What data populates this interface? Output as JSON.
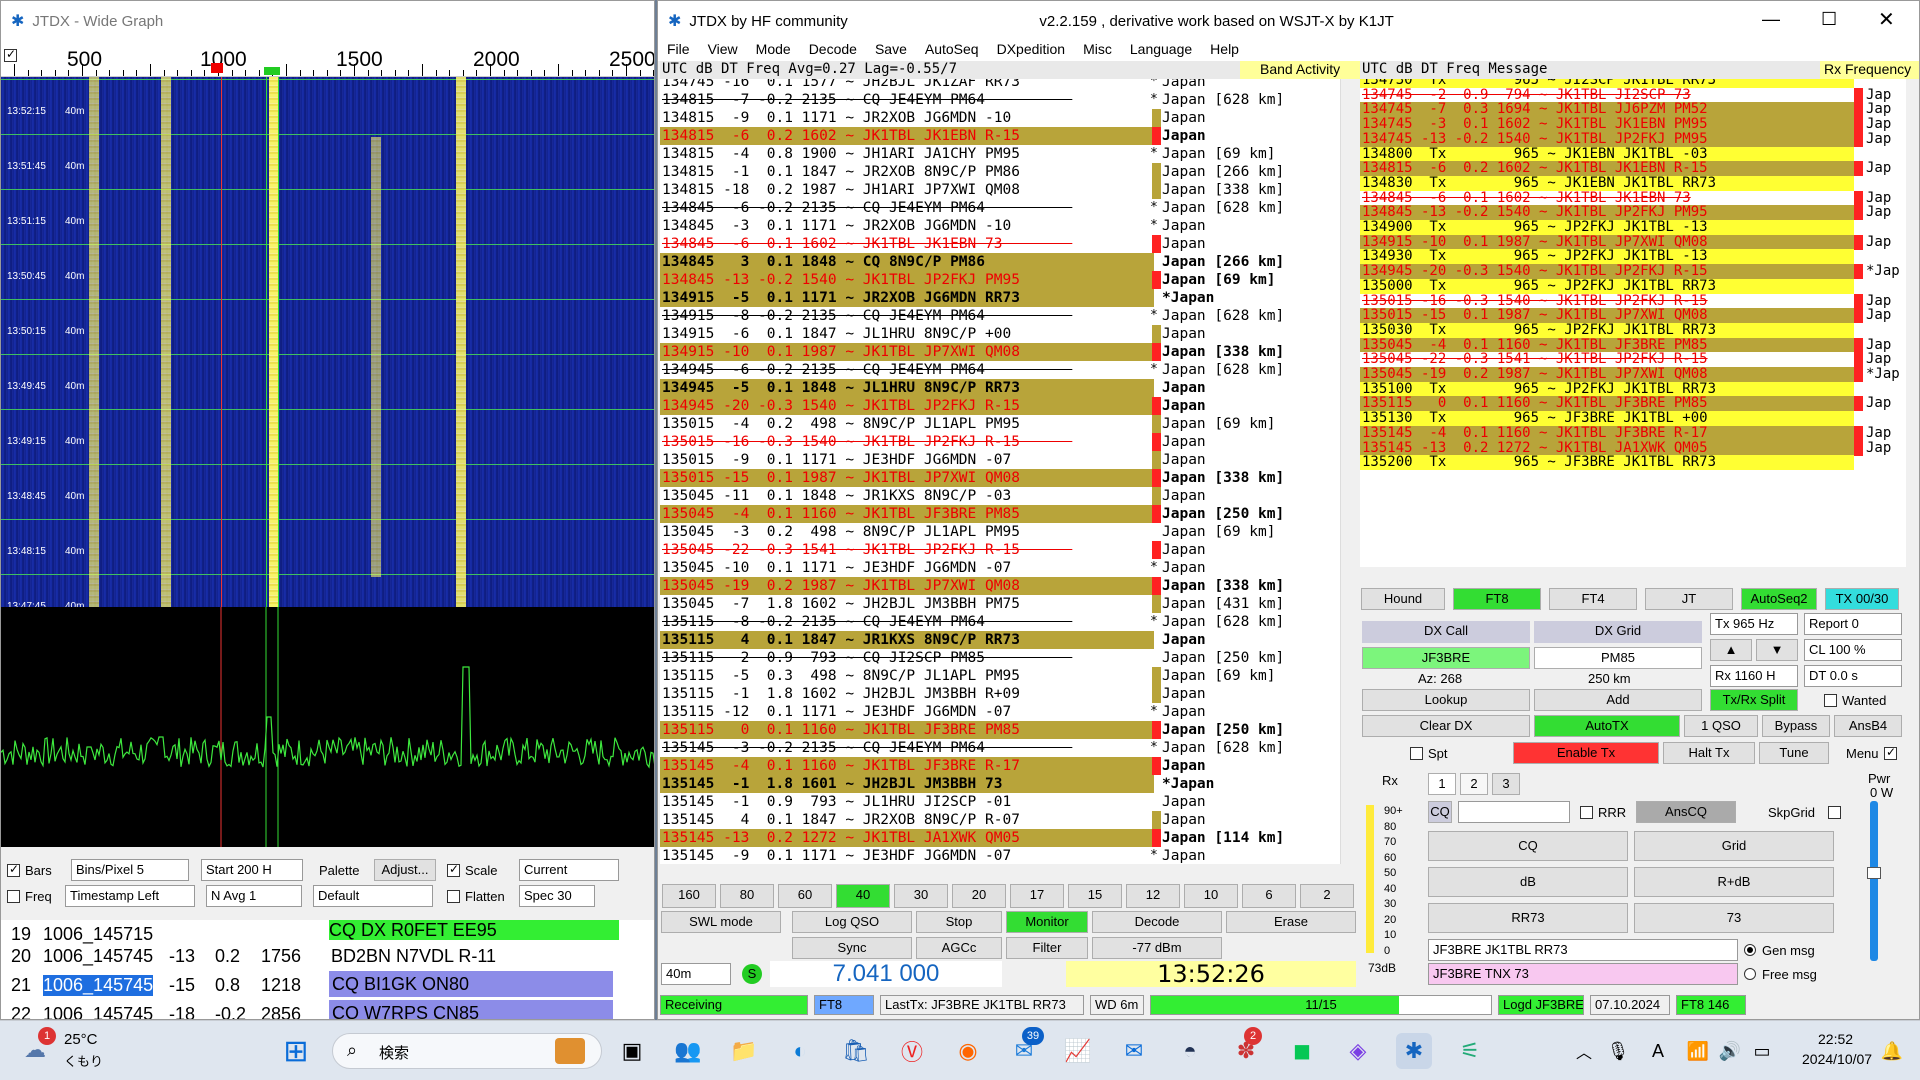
{
  "wide_graph": {
    "title": "JTDX - Wide Graph",
    "scale": [
      "500",
      "1000",
      "1500",
      "2000",
      "2500"
    ],
    "rows": [
      {
        "ts": "13:52:15",
        "band": "40m"
      },
      {
        "ts": "13:51:45",
        "band": "40m"
      },
      {
        "ts": "13:51:15",
        "band": "40m"
      },
      {
        "ts": "13:50:45",
        "band": "40m"
      },
      {
        "ts": "13:50:15",
        "band": "40m"
      },
      {
        "ts": "13:49:45",
        "band": "40m"
      },
      {
        "ts": "13:49:15",
        "band": "40m"
      },
      {
        "ts": "13:48:45",
        "band": "40m"
      },
      {
        "ts": "13:48:15",
        "band": "40m"
      },
      {
        "ts": "13:47:45",
        "band": "40m"
      }
    ],
    "ctrl": {
      "bars": "Bars",
      "bins": "Bins/Pixel  5",
      "start": "Start 200 H",
      "palette": "Palette",
      "adjust": "Adjust...",
      "scale": "Scale",
      "current": "Current",
      "freq": "Freq",
      "timestamp": "Timestamp Left",
      "navg": "N Avg 1",
      "default": "Default",
      "flatten": "Flatten",
      "spec": "Spec 30"
    }
  },
  "log_table": [
    {
      "n": "19",
      "d": "1006_145715",
      "c": "CQ DX R0FET EE95"
    },
    {
      "n": "20",
      "d": "1006_145745",
      "db": "-13",
      "dt": "0.2",
      "f": "1756",
      "m": "BD2BN N7VDL R-11"
    },
    {
      "n": "21",
      "d": "1006_145745",
      "db": "-15",
      "dt": "0.8",
      "f": "1218",
      "m": "CQ BI1GK ON80"
    },
    {
      "n": "22",
      "d": "1006_145745",
      "db": "-18",
      "dt": "-0.2",
      "f": "2856",
      "m": "CQ W7RPS CN85"
    }
  ],
  "main": {
    "title": "JTDX  by HF community",
    "subtitle": "v2.2.159 , derivative work based on WSJT-X by K1JT",
    "menu": [
      "File",
      "View",
      "Mode",
      "Decode",
      "Save",
      "AutoSeq",
      "DXpedition",
      "Misc",
      "Language",
      "Help"
    ],
    "band_header": "UTC    dB  DT Freq    Avg=0.27 Lag=-0.55/7",
    "band_activity": "Band Activity",
    "rx_header": "UTC    dB  DT Freq    Message",
    "rx_frequency": "Rx Frequency"
  },
  "band_rows": [
    {
      "t": "134745 -16  0.1 1577 ~ JH2BJL JK1ZAF RR73      ",
      "c": "Japan",
      "k": "",
      "s": "x",
      "m": "*"
    },
    {
      "t": "134815  -7 -0.2 2135 ~ CQ JE4EYM PM64          ",
      "c": "Japan [628 km]",
      "k": "",
      "s": "cq",
      "m": "*"
    },
    {
      "t": "134815  -9  0.1 1171 ~ JR2XOB JG6MDN -10       ",
      "c": "Japan",
      "k": "",
      "s": "",
      "m": "o"
    },
    {
      "t": "134815  -6  0.2 1602 ~ JK1TBL JK1EBN R-15      ",
      "c": "Japan",
      "k": "ol",
      "s": "red",
      "m": "r"
    },
    {
      "t": "134815  -4  0.8 1900 ~ JH1ARI JA1CHY PM95      ",
      "c": "Japan [69 km]",
      "k": "",
      "s": "",
      "m": "*"
    },
    {
      "t": "134815  -1  0.1 1847 ~ JR2XOB 8N9C/P PM86      ",
      "c": "Japan [266 km]",
      "k": "",
      "s": "",
      "m": "o"
    },
    {
      "t": "134815 -18  0.2 1987 ~ JH1ARI JP7XWI QM08      ",
      "c": "Japan [338 km]",
      "k": "",
      "s": "",
      "m": "o"
    },
    {
      "t": "134845  -6 -0.2 2135 ~ CQ JE4EYM PM64          ",
      "c": "Japan [628 km]",
      "k": "",
      "s": "cq",
      "m": "*"
    },
    {
      "t": "134845  -3  0.1 1171 ~ JR2XOB JG6MDN -10       ",
      "c": "Japan",
      "k": "",
      "s": "",
      "m": "*"
    },
    {
      "t": "134845  -6  0.1 1602 ~ JK1TBL JK1EBN 73        ",
      "c": "Japan",
      "k": "",
      "s": "strike",
      "m": "r"
    },
    {
      "t": "134845   3  0.1 1848 ~ CQ 8N9C/P PM86          ",
      "c": "Japan [266 km]",
      "k": "ol",
      "s": "bold",
      "m": ""
    },
    {
      "t": "134845 -13 -0.2 1540 ~ JK1TBL JP2FKJ PM95      ",
      "c": "Japan [69 km]",
      "k": "ol",
      "s": "red",
      "m": "r"
    },
    {
      "t": "134915  -5  0.1 1171 ~ JR2XOB JG6MDN RR73      ",
      "c": "*Japan",
      "k": "ol",
      "s": "bold",
      "m": ""
    },
    {
      "t": "134915  -8 -0.2 2135 ~ CQ JE4EYM PM64          ",
      "c": "Japan [628 km]",
      "k": "",
      "s": "cq",
      "m": "*"
    },
    {
      "t": "134915  -6  0.1 1847 ~ JL1HRU 8N9C/P +00       ",
      "c": "Japan",
      "k": "",
      "s": "",
      "m": "o"
    },
    {
      "t": "134915 -10  0.1 1987 ~ JK1TBL JP7XWI QM08      ",
      "c": "Japan [338 km]",
      "k": "ol",
      "s": "red",
      "m": "r"
    },
    {
      "t": "134945  -6 -0.2 2135 ~ CQ JE4EYM PM64          ",
      "c": "Japan [628 km]",
      "k": "",
      "s": "cq",
      "m": "*"
    },
    {
      "t": "134945  -5  0.1 1848 ~ JL1HRU 8N9C/P RR73      ",
      "c": "Japan",
      "k": "ol",
      "s": "bold",
      "m": ""
    },
    {
      "t": "134945 -20 -0.3 1540 ~ JK1TBL JP2FKJ R-15      ",
      "c": "Japan",
      "k": "ol",
      "s": "red",
      "m": "r"
    },
    {
      "t": "135015  -4  0.2  498 ~ 8N9C/P JL1APL PM95      ",
      "c": "Japan [69 km]",
      "k": "",
      "s": "",
      "m": "o"
    },
    {
      "t": "135015 -16 -0.3 1540 ~ JK1TBL JP2FKJ R-15      ",
      "c": "Japan",
      "k": "",
      "s": "strike",
      "m": "r"
    },
    {
      "t": "135015  -9  0.1 1171 ~ JE3HDF JG6MDN -07       ",
      "c": "Japan",
      "k": "",
      "s": "",
      "m": "o"
    },
    {
      "t": "135015 -15  0.1 1987 ~ JK1TBL JP7XWI QM08      ",
      "c": "Japan [338 km]",
      "k": "ol",
      "s": "red",
      "m": "r"
    },
    {
      "t": "135045 -11  0.1 1848 ~ JR1KXS 8N9C/P -03       ",
      "c": "Japan",
      "k": "",
      "s": "",
      "m": "o"
    },
    {
      "t": "135045  -4  0.1 1160 ~ JK1TBL JF3BRE PM85      ",
      "c": "Japan [250 km]",
      "k": "ol",
      "s": "red",
      "m": "r"
    },
    {
      "t": "135045  -3  0.2  498 ~ 8N9C/P JL1APL PM95      ",
      "c": "Japan [69 km]",
      "k": "",
      "s": "",
      "m": ""
    },
    {
      "t": "135045 -22 -0.3 1541 ~ JK1TBL JP2FKJ R-15      ",
      "c": "Japan",
      "k": "",
      "s": "strike",
      "m": "r"
    },
    {
      "t": "135045 -10  0.1 1171 ~ JE3HDF JG6MDN -07       ",
      "c": "Japan",
      "k": "",
      "s": "",
      "m": "*"
    },
    {
      "t": "135045 -19  0.2 1987 ~ JK1TBL JP7XWI QM08      ",
      "c": "Japan [338 km]",
      "k": "ol",
      "s": "red",
      "m": "r"
    },
    {
      "t": "135045  -7  1.8 1602 ~ JH2BJL JM3BBH PM75      ",
      "c": "Japan [431 km]",
      "k": "",
      "s": "",
      "m": "o"
    },
    {
      "t": "135115  -8 -0.2 2135 ~ CQ JE4EYM PM64          ",
      "c": "Japan [628 km]",
      "k": "",
      "s": "cq",
      "m": "*"
    },
    {
      "t": "135115   4  0.1 1847 ~ JR1KXS 8N9C/P RR73      ",
      "c": "Japan",
      "k": "ol",
      "s": "bold",
      "m": ""
    },
    {
      "t": "135115   2  0.9  793 ~ CQ JI2SCP PM85          ",
      "c": "Japan [250 km]",
      "k": "",
      "s": "cq",
      "m": ""
    },
    {
      "t": "135115  -5  0.3  498 ~ 8N9C/P JL1APL PM95      ",
      "c": "Japan [69 km]",
      "k": "",
      "s": "",
      "m": "o"
    },
    {
      "t": "135115  -1  1.8 1602 ~ JH2BJL JM3BBH R+09      ",
      "c": "Japan",
      "k": "",
      "s": "",
      "m": "o"
    },
    {
      "t": "135115 -12  0.1 1171 ~ JE3HDF JG6MDN -07       ",
      "c": "Japan",
      "k": "",
      "s": "",
      "m": "*"
    },
    {
      "t": "135115   0  0.1 1160 ~ JK1TBL JF3BRE PM85      ",
      "c": "Japan [250 km]",
      "k": "ol",
      "s": "red",
      "m": "r"
    },
    {
      "t": "135145  -3 -0.2 2135 ~ CQ JE4EYM PM64          ",
      "c": "Japan [628 km]",
      "k": "",
      "s": "cq",
      "m": "*"
    },
    {
      "t": "135145  -4  0.1 1160 ~ JK1TBL JF3BRE R-17      ",
      "c": "Japan",
      "k": "ol",
      "s": "red",
      "m": "r"
    },
    {
      "t": "135145  -1  1.8 1601 ~ JH2BJL JM3BBH 73        ",
      "c": "*Japan",
      "k": "ol",
      "s": "bold",
      "m": ""
    },
    {
      "t": "135145  -1  0.9  793 ~ JL1HRU JI2SCP -01       ",
      "c": "Japan",
      "k": "",
      "s": "",
      "m": ""
    },
    {
      "t": "135145   4  0.1 1847 ~ JR2XOB 8N9C/P R-07      ",
      "c": "Japan",
      "k": "",
      "s": "",
      "m": "o"
    },
    {
      "t": "135145 -13  0.2 1272 ~ JK1TBL JA1XWK QM05      ",
      "c": "Japan [114 km]",
      "k": "ol",
      "s": "red",
      "m": "r"
    },
    {
      "t": "135145  -9  0.1 1171 ~ JE3HDF JG6MDN -07       ",
      "c": "Japan",
      "k": "",
      "s": "",
      "m": "*"
    }
  ],
  "rx_rows": [
    {
      "t": "134730  Tx        965 ~ JI2SCP JK1TBL RR73",
      "c": "",
      "k": "yel",
      "s": ""
    },
    {
      "t": "134745  -2  0.9  794 ~ JK1TBL JI2SCP 73",
      "c": "Jap",
      "k": "",
      "s": "strike"
    },
    {
      "t": "134745  -7  0.3 1694 ~ JK1TBL JJ6PZM PM52",
      "c": "Jap",
      "k": "ol",
      "s": "red"
    },
    {
      "t": "134745  -3  0.1 1602 ~ JK1TBL JK1EBN PM95",
      "c": "Jap",
      "k": "ol",
      "s": "red"
    },
    {
      "t": "134745 -13 -0.2 1540 ~ JK1TBL JP2FKJ PM95",
      "c": "Jap",
      "k": "ol",
      "s": "red"
    },
    {
      "t": "134800  Tx        965 ~ JK1EBN JK1TBL -03",
      "c": "",
      "k": "yel",
      "s": ""
    },
    {
      "t": "134815  -6  0.2 1602 ~ JK1TBL JK1EBN R-15",
      "c": "Jap",
      "k": "ol",
      "s": "red"
    },
    {
      "t": "134830  Tx        965 ~ JK1EBN JK1TBL RR73",
      "c": "",
      "k": "yel",
      "s": ""
    },
    {
      "t": "134845  -6  0.1 1602 ~ JK1TBL JK1EBN 73",
      "c": "Jap",
      "k": "",
      "s": "strike"
    },
    {
      "t": "134845 -13 -0.2 1540 ~ JK1TBL JP2FKJ PM95",
      "c": "Jap",
      "k": "ol",
      "s": "red"
    },
    {
      "t": "134900  Tx        965 ~ JP2FKJ JK1TBL -13",
      "c": "",
      "k": "yel",
      "s": ""
    },
    {
      "t": "134915 -10  0.1 1987 ~ JK1TBL JP7XWI QM08",
      "c": "Jap",
      "k": "ol",
      "s": "red"
    },
    {
      "t": "134930  Tx        965 ~ JP2FKJ JK1TBL -13",
      "c": "",
      "k": "yel",
      "s": ""
    },
    {
      "t": "134945 -20 -0.3 1540 ~ JK1TBL JP2FKJ R-15",
      "c": "*Jap",
      "k": "ol",
      "s": "red"
    },
    {
      "t": "135000  Tx        965 ~ JP2FKJ JK1TBL RR73",
      "c": "",
      "k": "yel",
      "s": ""
    },
    {
      "t": "135015 -16 -0.3 1540 ~ JK1TBL JP2FKJ R-15",
      "c": "Jap",
      "k": "",
      "s": "strike"
    },
    {
      "t": "135015 -15  0.1 1987 ~ JK1TBL JP7XWI QM08",
      "c": "Jap",
      "k": "ol",
      "s": "red"
    },
    {
      "t": "135030  Tx        965 ~ JP2FKJ JK1TBL RR73",
      "c": "",
      "k": "yel",
      "s": ""
    },
    {
      "t": "135045  -4  0.1 1160 ~ JK1TBL JF3BRE PM85",
      "c": "Jap",
      "k": "ol",
      "s": "red"
    },
    {
      "t": "135045 -22 -0.3 1541 ~ JK1TBL JP2FKJ R-15",
      "c": "Jap",
      "k": "",
      "s": "strike"
    },
    {
      "t": "135045 -19  0.2 1987 ~ JK1TBL JP7XWI QM08",
      "c": "*Jap",
      "k": "ol",
      "s": "red"
    },
    {
      "t": "135100  Tx        965 ~ JP2FKJ JK1TBL RR73",
      "c": "",
      "k": "yel",
      "s": ""
    },
    {
      "t": "135115   0  0.1 1160 ~ JK1TBL JF3BRE PM85",
      "c": "Jap",
      "k": "ol",
      "s": "red"
    },
    {
      "t": "135130  Tx        965 ~ JF3BRE JK1TBL +00",
      "c": "",
      "k": "yel",
      "s": ""
    },
    {
      "t": "135145  -4  0.1 1160 ~ JK1TBL JF3BRE R-17",
      "c": "Jap",
      "k": "ol",
      "s": "red"
    },
    {
      "t": "135145 -13  0.2 1272 ~ JK1TBL JA1XWK QM05",
      "c": "Jap",
      "k": "ol",
      "s": "red"
    },
    {
      "t": "135200  Tx        965 ~ JF3BRE JK1TBL RR73",
      "c": "",
      "k": "yel",
      "s": ""
    }
  ],
  "bands": [
    "160",
    "80",
    "60",
    "40",
    "30",
    "20",
    "17",
    "15",
    "12",
    "10",
    "6",
    "2"
  ],
  "controls": {
    "swl": "SWL mode",
    "logqso": "Log QSO",
    "stop": "Stop",
    "monitor": "Monitor",
    "decode": "Decode",
    "erase": "Erase",
    "sync": "Sync",
    "agcc": "AGCc",
    "filter": "Filter",
    "dbm": "-77 dBm",
    "band": "40m",
    "s": "S",
    "freq": "7.041 000",
    "clock": "13:52:26",
    "hound": "Hound",
    "ft8": "FT8",
    "ft4": "FT4",
    "jt": "JT",
    "autoseq": "AutoSeq2",
    "tx3030": "TX 00/30",
    "dxcall_l": "DX Call",
    "dxgrid_l": "DX Grid",
    "dxcall": "JF3BRE",
    "dxgrid": "PM85",
    "az": "Az: 268",
    "dist": "250 km",
    "lookup": "Lookup",
    "add": "Add",
    "cleardx": "Clear DX",
    "autotx": "AutoTX",
    "qso1": "1 QSO",
    "bypass": "Bypass",
    "ansb4": "AnsB4",
    "spt": "Spt",
    "enabletx": "Enable Tx",
    "halttx": "Halt Tx",
    "tune": "Tune",
    "menu": "Menu",
    "tx": "Tx  965  Hz",
    "report": "Report 0",
    "cl": "CL  100 %",
    "rx": "Rx  1160  H",
    "dt": "DT 0.0 s",
    "txrxsplit": "Tx/Rx Split",
    "wanted": "Wanted",
    "rxlbl": "Rx",
    "pwr": "Pwr",
    "pwrval": "0 W",
    "tab1": "1",
    "tab2": "2",
    "tab3": "3",
    "cq": "CQ",
    "rrr": "RRR",
    "anscq": "AnsCQ",
    "skpgrid": "SkpGrid",
    "cqbtn": "CQ",
    "grid": "Grid",
    "db": "dB",
    "rdb": "R+dB",
    "rr73": "RR73",
    "n73": "73",
    "genmsg": "JF3BRE JK1TBL RR73",
    "freemsg": "JF3BRE TNX 73",
    "genmsg_l": "Gen msg",
    "freemsg_l": "Free msg",
    "meter": [
      "90+",
      "80",
      "70",
      "60",
      "50",
      "40",
      "30",
      "20",
      "10",
      "0"
    ],
    "meterdb": "73dB"
  },
  "status": {
    "receiving": "Receiving",
    "mode": "FT8",
    "lasttx": "LastTx: JF3BRE JK1TBL RR73",
    "wd": "WD 6m",
    "progress": "11/15",
    "progress_frac": 0.73,
    "logd": "Logd JF3BRE",
    "date": "07.10.2024",
    "ft8n": "FT8  146"
  },
  "taskbar": {
    "temp": "25°C",
    "weather": "くもり",
    "search": "検索",
    "time": "22:52",
    "date": "2024/10/07",
    "badge1": "1",
    "badge2": "39",
    "badge3": "2"
  }
}
